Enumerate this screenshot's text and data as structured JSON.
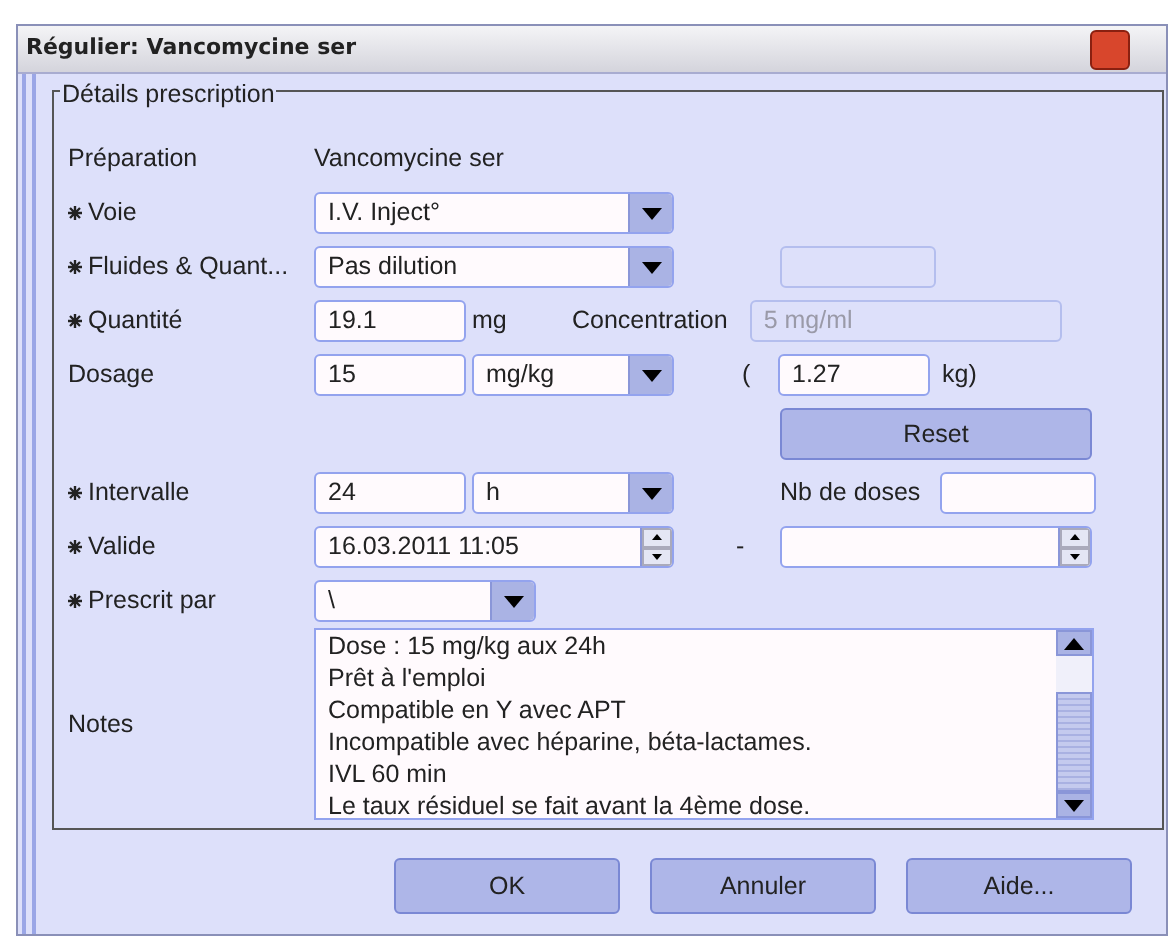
{
  "window": {
    "title": "Régulier: Vancomycine ser"
  },
  "details": {
    "legend": "Détails prescription",
    "preparation": {
      "label": "Préparation",
      "required": false,
      "value": "Vancomycine ser"
    },
    "voie": {
      "label": "Voie",
      "required": true,
      "value": "I.V. Inject°"
    },
    "fluides": {
      "label": "Fluides & Quant...",
      "required": true,
      "value": "Pas dilution",
      "extra_disabled": true
    },
    "quantite": {
      "label": "Quantité",
      "required": true,
      "value": "19.1",
      "unit": "mg",
      "concentration_label": "Concentration",
      "concentration": {
        "value": "5 mg/ml",
        "disabled": true
      }
    },
    "dosage": {
      "label": "Dosage",
      "required": false,
      "value": "15",
      "unit": "mg/kg",
      "open_paren": "(",
      "weight": "1.27",
      "weight_unit": "kg)"
    },
    "reset": "Reset",
    "intervalle": {
      "label": "Intervalle",
      "required": true,
      "value": "24",
      "unit": "h",
      "doses_label": "Nb de doses"
    },
    "valide": {
      "label": "Valide",
      "required": true,
      "from": "16.03.2011 11:05",
      "separator": "-"
    },
    "prescrit": {
      "label": "Prescrit par",
      "required": true,
      "value": "\\"
    },
    "notes": {
      "label": "Notes",
      "required": false,
      "lines": [
        "Dose : 15 mg/kg aux 24h",
        "Prêt à l'emploi",
        "Compatible en Y avec APT",
        "Incompatible avec héparine, béta-lactames.",
        "IVL 60 min",
        "Le taux résiduel se fait avant la 4ème dose."
      ]
    }
  },
  "buttons": [
    "OK",
    "Annuler",
    "Aide..."
  ]
}
